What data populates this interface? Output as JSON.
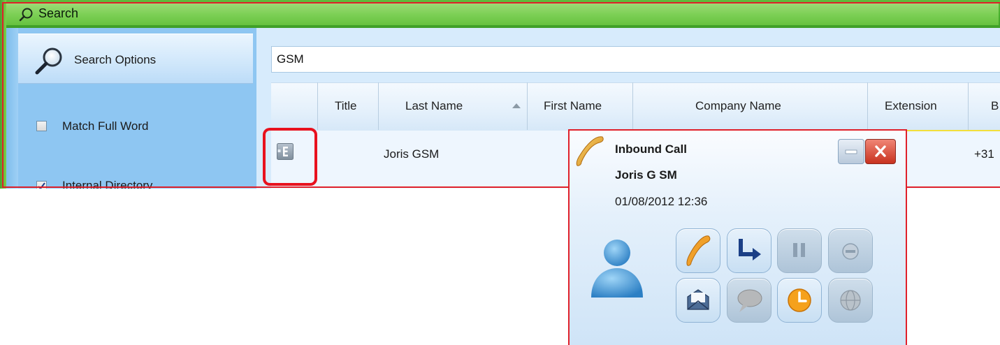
{
  "window": {
    "title": "Search"
  },
  "sidebar": {
    "header_label": "Search Options",
    "options": [
      {
        "label": "Match Full Word",
        "checked": false
      },
      {
        "label": "Internal Directory",
        "checked": true
      }
    ]
  },
  "search": {
    "value": "GSM"
  },
  "grid": {
    "columns": [
      "Title",
      "Last Name",
      "First Name",
      "Company Name",
      "Extension",
      "B"
    ],
    "sorted_column": "Last Name",
    "rows": [
      {
        "type_badge": "E",
        "title": "",
        "last_name": "Joris GSM",
        "phone_fragment": "+31"
      }
    ]
  },
  "toast": {
    "title": "Inbound Call",
    "caller": "Joris G SM",
    "datetime": "01/08/2012 12:36",
    "actions": [
      {
        "icon": "answer-handset-icon",
        "enabled": true
      },
      {
        "icon": "transfer-arrow-icon",
        "enabled": true
      },
      {
        "icon": "hold-pause-icon",
        "enabled": false
      },
      {
        "icon": "hangup-icon",
        "enabled": false
      },
      {
        "icon": "email-icon",
        "enabled": true
      },
      {
        "icon": "chat-bubble-icon",
        "enabled": false
      },
      {
        "icon": "clock-reminder-icon",
        "enabled": true
      },
      {
        "icon": "globe-icon",
        "enabled": false
      }
    ]
  },
  "colors": {
    "titlebar_green": "#5fbd3a",
    "sidebar_blue": "#8ec6f2",
    "highlight_red": "#e8121e"
  }
}
